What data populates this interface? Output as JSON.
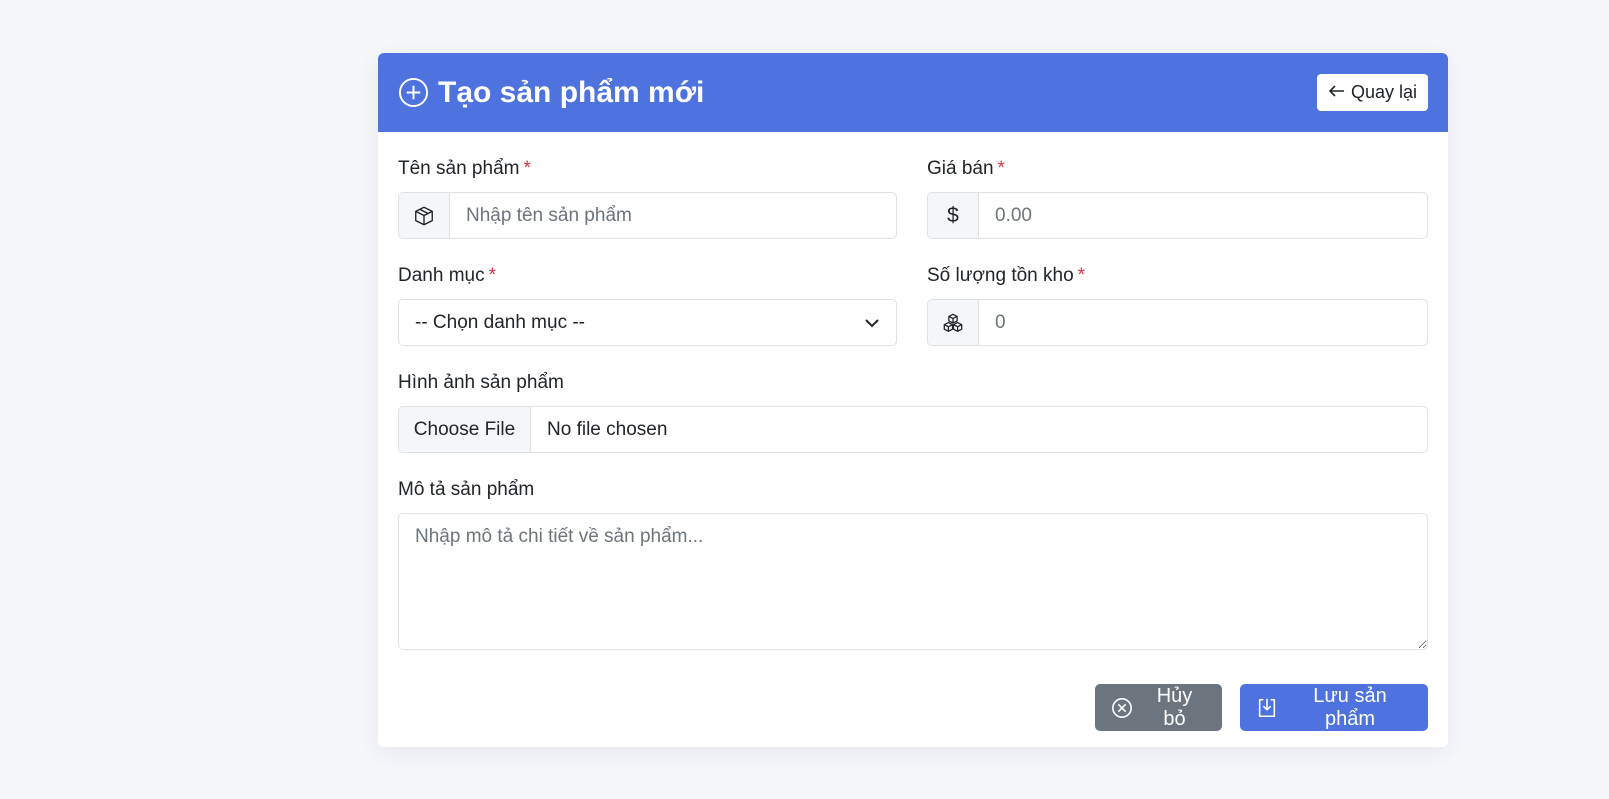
{
  "colors": {
    "primary": "#4e73df",
    "secondary": "#6c757d",
    "required": "#dc3545",
    "page_background": "#f6f7fb"
  },
  "header": {
    "icon": "plus-circle-icon",
    "title": "Tạo sản phẩm mới",
    "back_label": "Quay lại",
    "back_icon": "arrow-left-icon"
  },
  "form": {
    "name": {
      "label": "Tên sản phẩm",
      "required_mark": "*",
      "icon": "box-icon",
      "placeholder": "Nhập tên sản phẩm",
      "value": ""
    },
    "price": {
      "label": "Giá bán",
      "required_mark": "*",
      "addon": "$",
      "placeholder": "0.00",
      "value": ""
    },
    "category": {
      "label": "Danh mục",
      "required_mark": "*",
      "selected": "-- Chọn danh mục --"
    },
    "stock": {
      "label": "Số lượng tồn kho",
      "required_mark": "*",
      "icon": "boxes-icon",
      "placeholder": "0",
      "value": ""
    },
    "image": {
      "label": "Hình ảnh sản phẩm",
      "button_label": "Choose File",
      "status": "No file chosen"
    },
    "description": {
      "label": "Mô tả sản phẩm",
      "placeholder": "Nhập mô tả chi tiết về sản phẩm...",
      "value": ""
    }
  },
  "actions": {
    "cancel_label": "Hủy bỏ",
    "cancel_icon": "x-circle-icon",
    "save_label": "Lưu sản phẩm",
    "save_icon": "save-icon"
  }
}
